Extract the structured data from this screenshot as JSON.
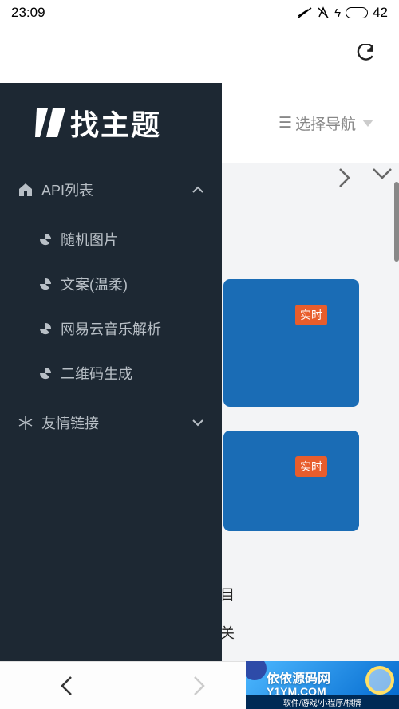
{
  "status": {
    "time": "23:09",
    "battery": "42"
  },
  "header": {
    "nav_label": "选择导航"
  },
  "sidebar": {
    "logo_text": "找主题",
    "menu1": {
      "label": "API列表"
    },
    "submenu": [
      "随机图片",
      "文案(温柔)",
      "网易云音乐解析",
      "二维码生成"
    ],
    "menu2": {
      "label": "友情链接"
    }
  },
  "content": {
    "badge": "实时",
    "partial1": "目",
    "partial2": "关"
  },
  "ad": {
    "title": "依依源码网",
    "url": "Y1YM.COM",
    "sub": "软件/游戏/小程序/棋牌"
  }
}
